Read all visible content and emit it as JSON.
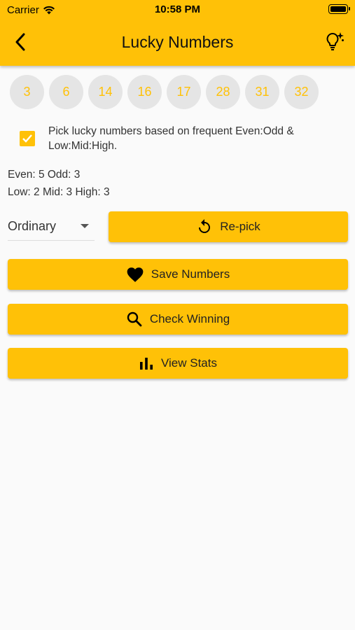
{
  "status_bar": {
    "carrier": "Carrier",
    "time": "10:58 PM"
  },
  "header": {
    "title": "Lucky Numbers"
  },
  "numbers": [
    "3",
    "6",
    "14",
    "16",
    "17",
    "28",
    "31",
    "32"
  ],
  "option": {
    "checked": true,
    "label": "Pick lucky numbers based on frequent Even:Odd & Low:Mid:High."
  },
  "stats": {
    "even_odd": "Even: 5 Odd: 3",
    "low_mid_high": "Low: 2 Mid: 3 High: 3"
  },
  "mode_select": {
    "selected": "Ordinary"
  },
  "buttons": {
    "repick": "Re-pick",
    "save": "Save Numbers",
    "check": "Check Winning",
    "stats": "View Stats"
  },
  "colors": {
    "accent": "#ffc107",
    "ball_bg": "#e5e5e5",
    "background": "#fafafa"
  }
}
